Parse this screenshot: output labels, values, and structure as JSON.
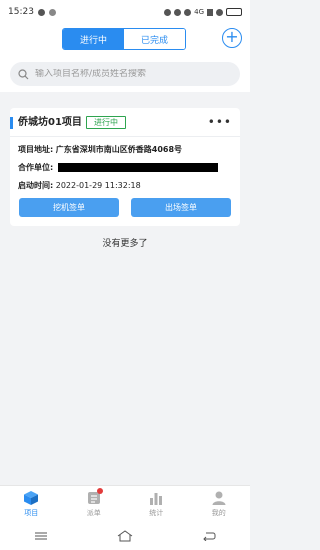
{
  "status_bar": {
    "time": "15:23",
    "network": "4G",
    "battery": ""
  },
  "header": {
    "tabs": [
      {
        "label": "进行中",
        "active": true
      },
      {
        "label": "已完成",
        "active": false
      }
    ],
    "add_icon": "plus-circle-icon"
  },
  "search": {
    "placeholder": "输入项目名称/成员姓名搜索",
    "value": ""
  },
  "projects": [
    {
      "title": "侨城坊01项目",
      "status": "进行中",
      "address_label": "项目地址:",
      "address": "广东省深圳市南山区侨香路4068号",
      "partner_label": "合作单位:",
      "start_label": "启动时间:",
      "start_time": "2022-01-29 11:32:18",
      "btn_machine": "挖机签单",
      "btn_exit": "出场签单"
    }
  ],
  "no_more_text": "没有更多了",
  "tabbar": {
    "items": [
      {
        "label": "项目",
        "icon": "cube-icon",
        "active": true
      },
      {
        "label": "派单",
        "icon": "dispatch-icon",
        "active": false,
        "badge": true
      },
      {
        "label": "统计",
        "icon": "bar-chart-icon",
        "active": false
      },
      {
        "label": "我的",
        "icon": "user-icon",
        "active": false
      }
    ]
  },
  "colors": {
    "accent": "#2a8cf0",
    "status_green": "#2ea44f",
    "badge_red": "#e23b3b"
  }
}
